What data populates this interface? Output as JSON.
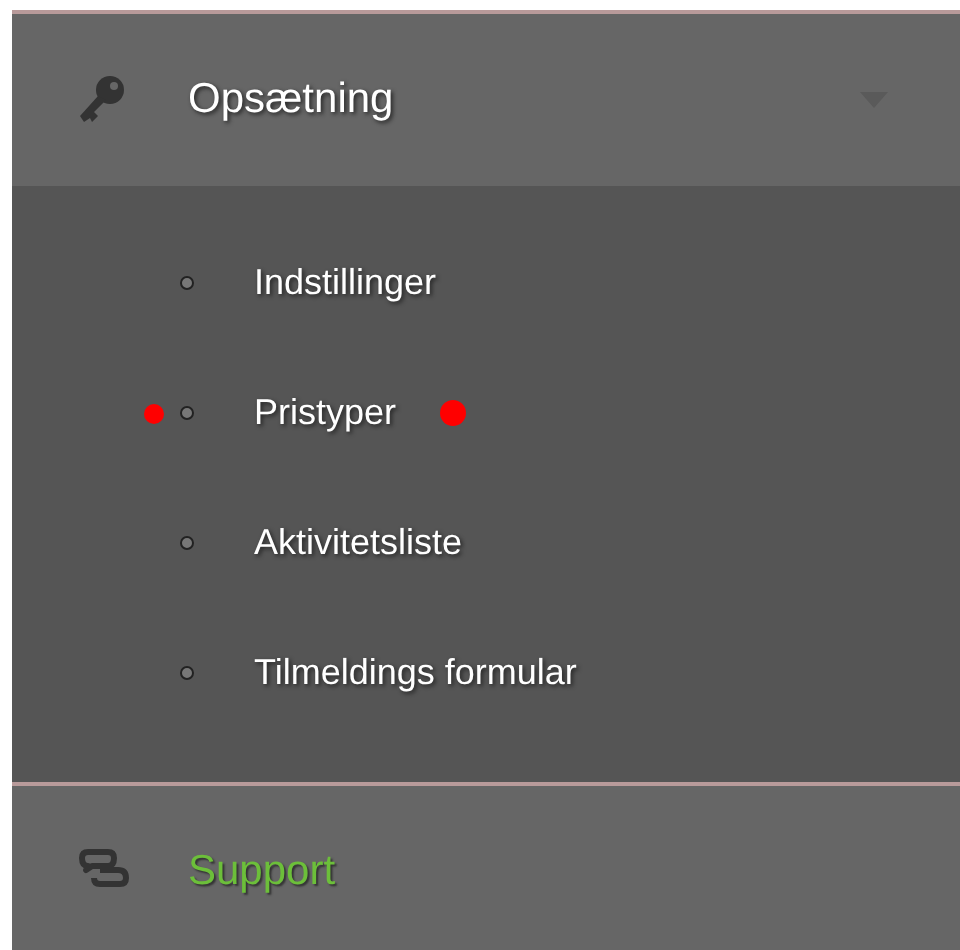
{
  "sections": [
    {
      "label": "Opsætning",
      "kind": "settings",
      "expanded": true,
      "active": false,
      "items": [
        {
          "label": "Indstillinger",
          "marked": false
        },
        {
          "label": "Pristyper",
          "marked": true
        },
        {
          "label": "Aktivitetsliste",
          "marked": false
        },
        {
          "label": "Tilmeldings formular",
          "marked": false
        }
      ]
    },
    {
      "label": "Support",
      "kind": "support",
      "expanded": false,
      "active": true
    }
  ]
}
